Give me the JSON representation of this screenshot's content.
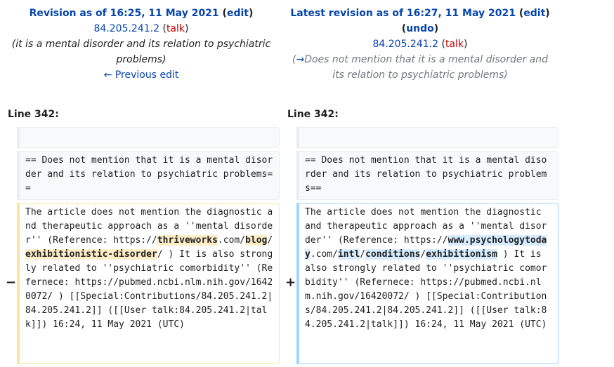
{
  "left_revision": {
    "title_link": "Revision as of 16:25, 11 May 2021",
    "edit_label": "edit",
    "user": "84.205.241.2",
    "talk_label": "talk",
    "summary": "(it is a mental disorder and its relation to psychiatric problems)",
    "previous_edit": "← Previous edit"
  },
  "right_revision": {
    "title_link": "Latest revision as of 16:27, 11 May 2021",
    "edit_label": "edit",
    "undo_label": "undo",
    "user": "84.205.241.2",
    "talk_label": "talk",
    "summary_arrow": "→",
    "summary_text": "Does not mention that it is a mental disorder and its relation to psychiatric problems"
  },
  "line_left": "Line 342:",
  "line_right": "Line 342:",
  "context_text": "== Does not mention that it is a mental disorder and its relation to psychiatric problems==",
  "markers": {
    "minus": "−",
    "plus": "+"
  },
  "deleted": {
    "pre": "The article does not mention the diagnostic and therapeutic approach as a ''mental disorder'' (Reference: https://",
    "hl1": "thriveworks",
    "mid1": ".com/",
    "hl2": "blog",
    "mid2": "/",
    "hl3": "exhibitionistic-disorder",
    "post": "/ ) It is also strongly related to ''psychiatric comorbidity'' (Refernece: https://pubmed.ncbi.nlm.nih.gov/16420072/ ) [[Special:Contributions/84.205.241.2|84.205.241.2]] ([[User talk:84.205.241.2|talk]]) 16:24, 11 May 2021 (UTC)"
  },
  "added": {
    "pre": "The article does not mention the diagnostic and therapeutic approach as a ''mental disorder'' (Reference: https://",
    "hl1": "www.psychologytoday",
    "mid1": ".com/",
    "hl2": "intl",
    "mid2": "/",
    "hl3": "conditions",
    "mid3": "/",
    "hl4": "exhibitionism",
    "post": " ) It is also strongly related to ''psychiatric comorbidity'' (Refernece: https://pubmed.ncbi.nlm.nih.gov/16420072/ ) [[Special:Contributions/84.205.241.2|84.205.241.2]] ([[User talk:84.205.241.2|talk]]) 16:24, 11 May 2021 (UTC)"
  }
}
